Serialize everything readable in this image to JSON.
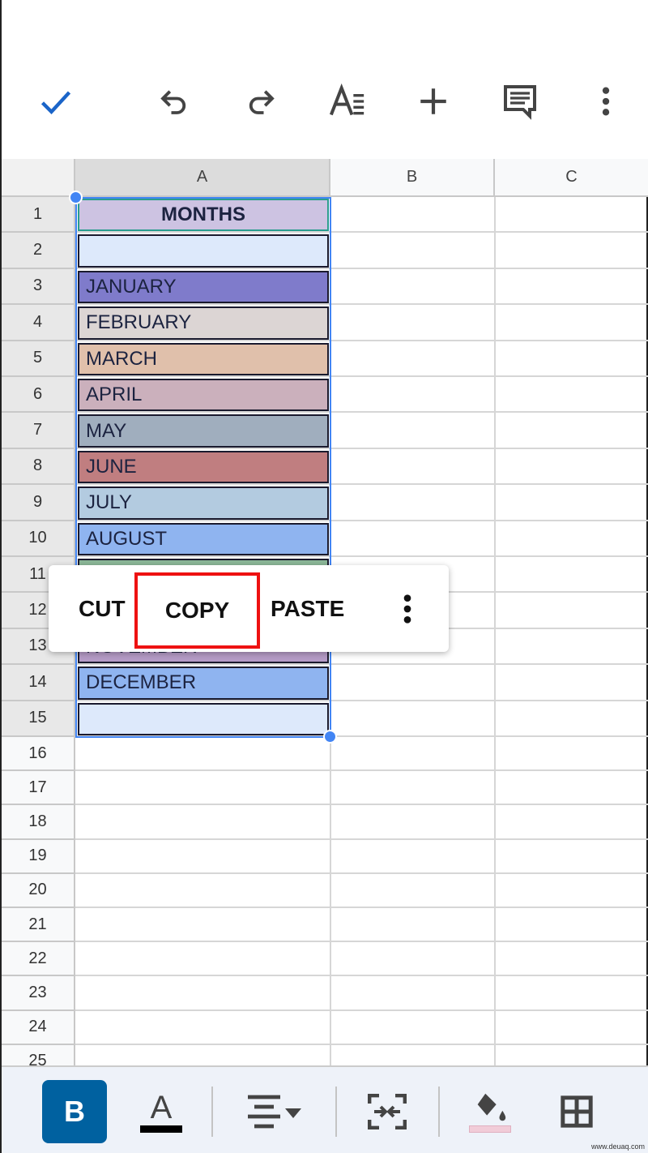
{
  "toolbar": {
    "icons": [
      "check-icon",
      "undo-icon",
      "redo-icon",
      "text-format-icon",
      "add-icon",
      "comment-icon",
      "more-vert-icon"
    ]
  },
  "columns": [
    "A",
    "B",
    "C"
  ],
  "rows": [
    "1",
    "2",
    "3",
    "4",
    "5",
    "6",
    "7",
    "8",
    "9",
    "10",
    "11",
    "12",
    "13",
    "14",
    "15",
    "16",
    "17",
    "18",
    "19",
    "20",
    "21",
    "22",
    "23",
    "24",
    "25"
  ],
  "cells": [
    {
      "row": "1",
      "text": "MONTHS",
      "bg": "#cdc3e2",
      "bold": true
    },
    {
      "row": "2",
      "text": "",
      "bg": "#dde9fb"
    },
    {
      "row": "3",
      "text": "JANUARY",
      "bg": "#7f7bcb"
    },
    {
      "row": "4",
      "text": "FEBRUARY",
      "bg": "#dcd5d4"
    },
    {
      "row": "5",
      "text": "MARCH",
      "bg": "#e0c0ab"
    },
    {
      "row": "6",
      "text": "APRIL",
      "bg": "#cbb0bc"
    },
    {
      "row": "7",
      "text": "MAY",
      "bg": "#a0aebe"
    },
    {
      "row": "8",
      "text": "JUNE",
      "bg": "#c07e80"
    },
    {
      "row": "9",
      "text": "JULY",
      "bg": "#b3cbe0"
    },
    {
      "row": "10",
      "text": "AUGUST",
      "bg": "#8fb4f0"
    },
    {
      "row": "11",
      "text": "",
      "bg": "#8bb797"
    },
    {
      "row": "12",
      "text": "",
      "bg": "#b59bc6"
    },
    {
      "row": "13",
      "text": "NOVEMBER",
      "bg": "#b59bc6"
    },
    {
      "row": "14",
      "text": "DECEMBER",
      "bg": "#8fb4f0"
    },
    {
      "row": "15",
      "text": "",
      "bg": "#dde9fb"
    }
  ],
  "context_menu": {
    "cut": "CUT",
    "copy": "COPY",
    "paste": "PASTE",
    "highlight_color": "#ee1111"
  },
  "bottom_toolbar": {
    "bold": "B",
    "text_color_label": "A",
    "text_color": "#000000",
    "fill_color": "#f1ccd8",
    "accent": "#0061a0"
  },
  "selection_color": "#4285f4",
  "watermark": "www.deuaq.com"
}
